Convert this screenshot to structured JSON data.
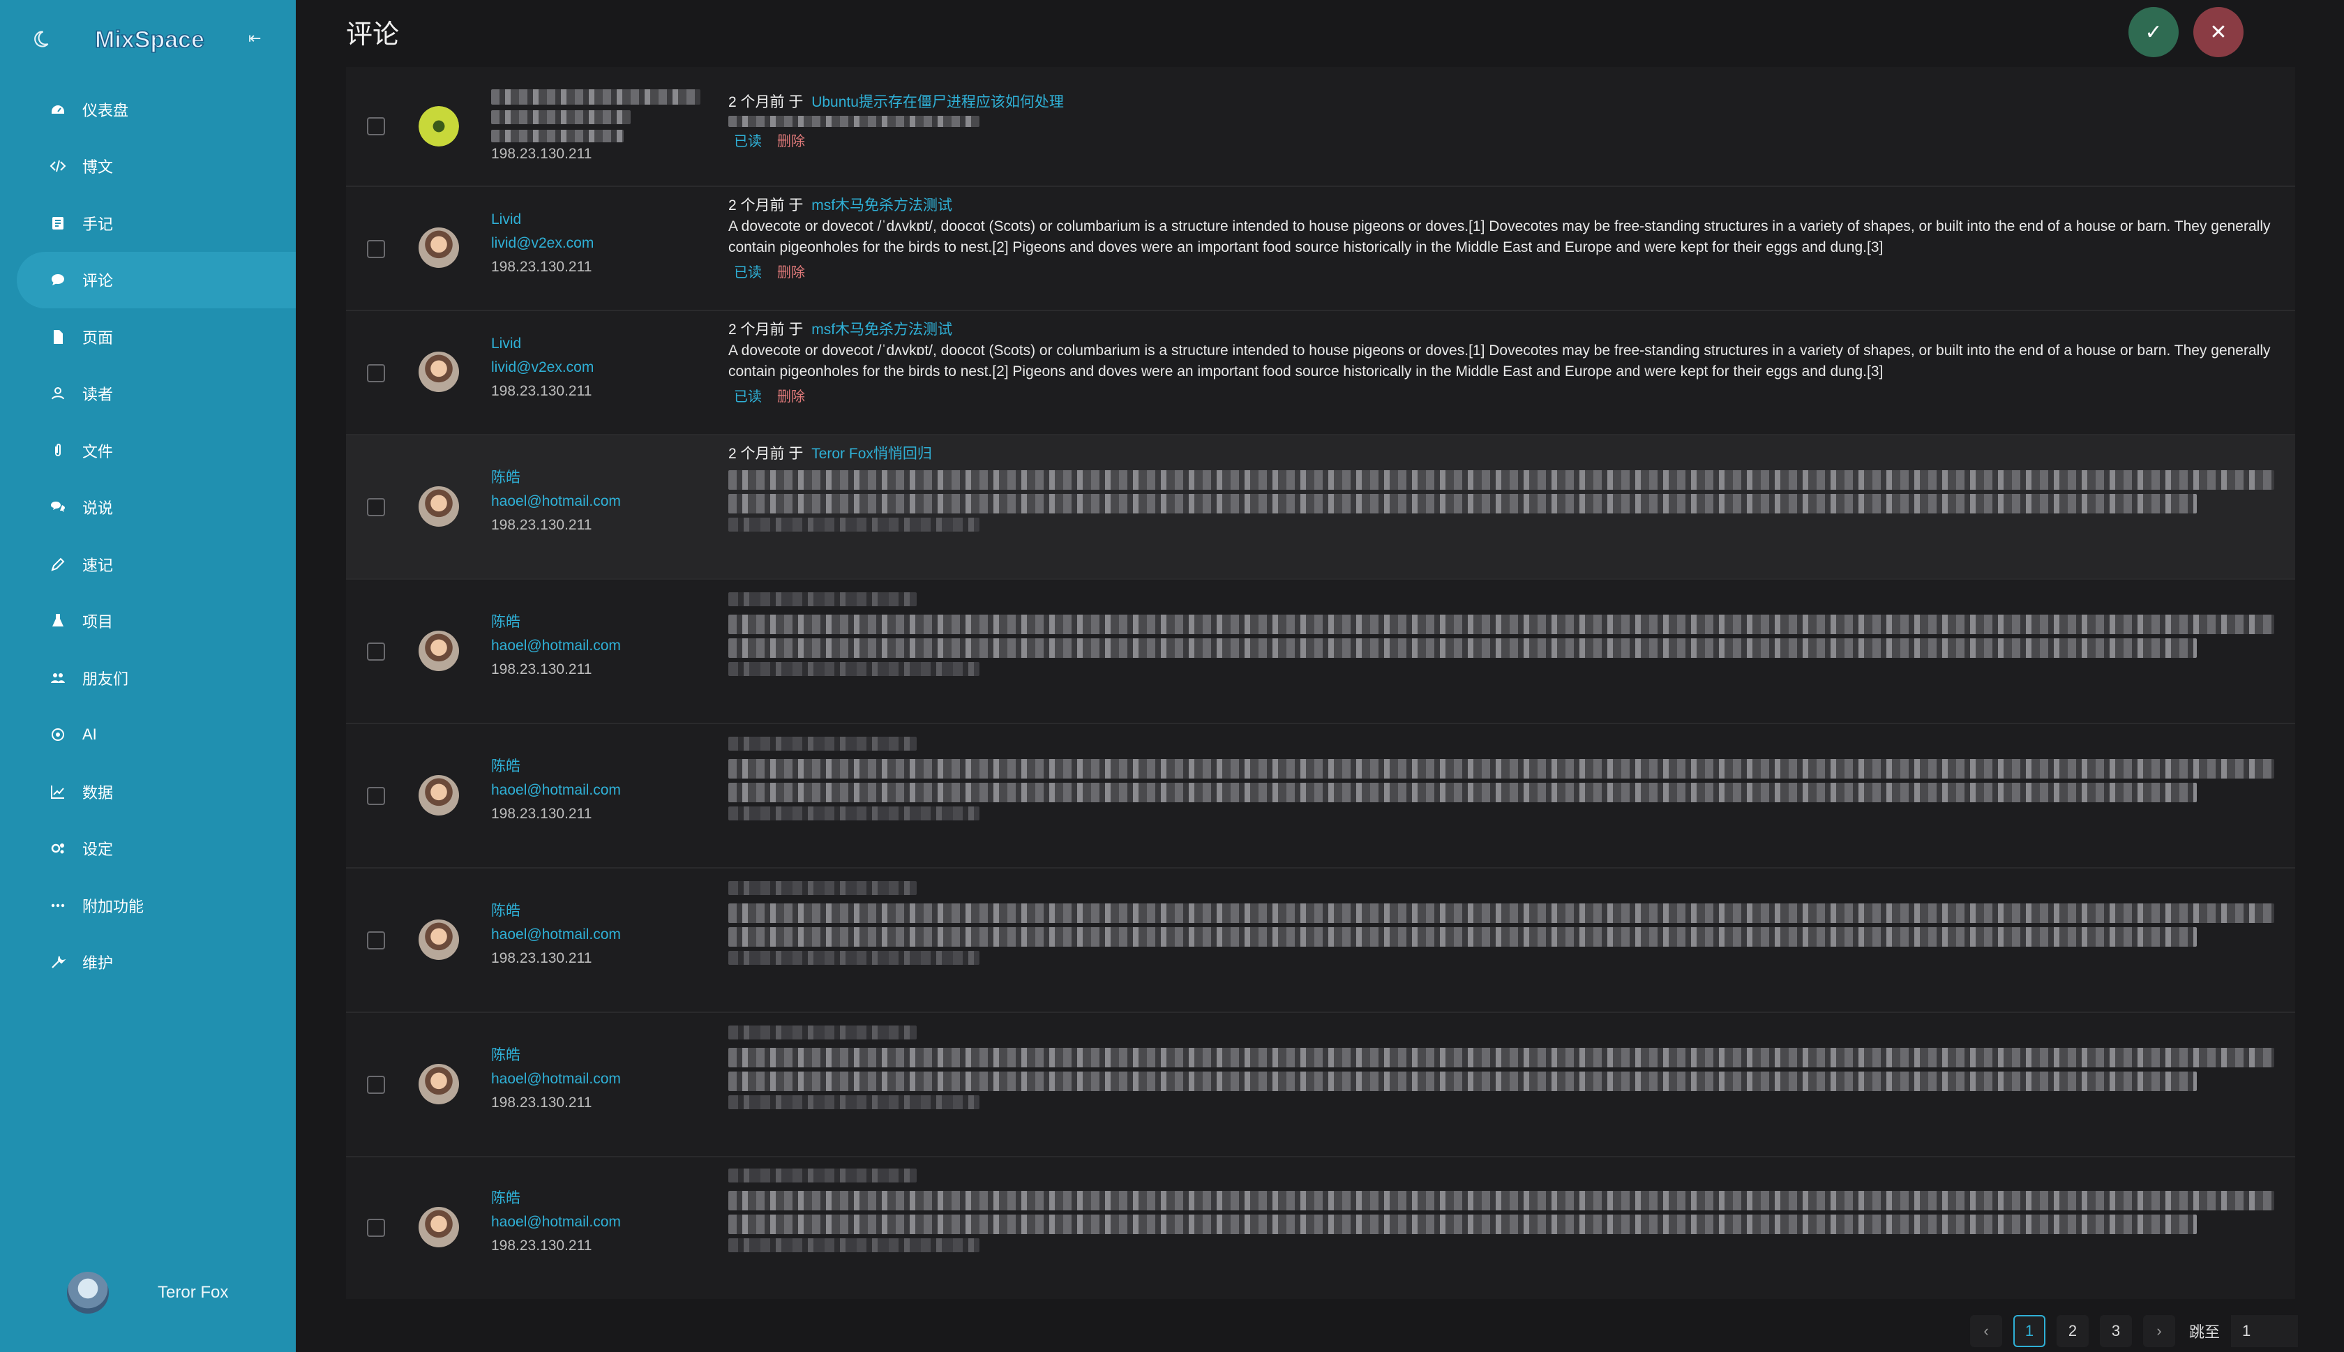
{
  "app": {
    "logo_text": "MixSpace",
    "user": "Teror Fox"
  },
  "sidebar": {
    "items": [
      {
        "label": "仪表盘",
        "icon": "dashboard-icon"
      },
      {
        "label": "博文",
        "icon": "code-icon"
      },
      {
        "label": "手记",
        "icon": "notebook-icon"
      },
      {
        "label": "评论",
        "icon": "comment-icon",
        "active": true
      },
      {
        "label": "页面",
        "icon": "page-icon"
      },
      {
        "label": "读者",
        "icon": "readers-icon"
      },
      {
        "label": "文件",
        "icon": "paperclip-icon"
      },
      {
        "label": "说说",
        "icon": "chat-icon"
      },
      {
        "label": "速记",
        "icon": "pencil-icon"
      },
      {
        "label": "项目",
        "icon": "flask-icon"
      },
      {
        "label": "朋友们",
        "icon": "friends-icon"
      },
      {
        "label": "AI",
        "icon": "ai-icon"
      },
      {
        "label": "数据",
        "icon": "chart-icon"
      },
      {
        "label": "设定",
        "icon": "settings-icon"
      },
      {
        "label": "附加功能",
        "icon": "more-icon"
      },
      {
        "label": "维护",
        "icon": "wrench-icon"
      }
    ]
  },
  "header": {
    "title": "评论",
    "ok_symbol": "✓",
    "cancel_symbol": "✕"
  },
  "comments": [
    {
      "name": "",
      "email": "",
      "ip": "198.23.130.211",
      "time": "2 个月前",
      "on": "于",
      "post": "Ubuntu提示存在僵尸进程应该如何处理",
      "text": "",
      "read": "已读",
      "delete": "删除"
    },
    {
      "name": "Livid",
      "email": "livid@v2ex.com",
      "ip": "198.23.130.211",
      "time": "2 个月前",
      "on": "于",
      "post": "msf木马免杀方法测试",
      "text": "A dovecote or dovecot /ˈdʌvkɒt/, doocot (Scots) or columbarium is a structure intended to house pigeons or doves.[1] Dovecotes may be free-standing structures in a variety of shapes, or built into the end of a house or barn. They generally contain pigeonholes for the birds to nest.[2] Pigeons and doves were an important food source historically in the Middle East and Europe and were kept for their eggs and dung.[3]",
      "read": "已读",
      "delete": "删除"
    },
    {
      "name": "Livid",
      "email": "livid@v2ex.com",
      "ip": "198.23.130.211",
      "time": "2 个月前",
      "on": "于",
      "post": "msf木马免杀方法测试",
      "text": "A dovecote or dovecot /ˈdʌvkɒt/, doocot (Scots) or columbarium is a structure intended to house pigeons or doves.[1] Dovecotes may be free-standing structures in a variety of shapes, or built into the end of a house or barn. They generally contain pigeonholes for the birds to nest.[2] Pigeons and doves were an important food source historically in the Middle East and Europe and were kept for their eggs and dung.[3]",
      "read": "已读",
      "delete": "删除"
    },
    {
      "name": "陈皓",
      "email": "haoel@hotmail.com",
      "ip": "198.23.130.211",
      "time": "2 个月前",
      "on": "于",
      "post": "Teror Fox悄悄回归",
      "text": "",
      "read": "",
      "delete": ""
    },
    {
      "name": "陈皓",
      "email": "haoel@hotmail.com",
      "ip": "198.23.130.211",
      "time": "",
      "on": "",
      "post": "",
      "text": "",
      "read": "",
      "delete": ""
    },
    {
      "name": "陈皓",
      "email": "haoel@hotmail.com",
      "ip": "198.23.130.211",
      "time": "",
      "on": "",
      "post": "",
      "text": "",
      "read": "",
      "delete": ""
    },
    {
      "name": "陈皓",
      "email": "haoel@hotmail.com",
      "ip": "198.23.130.211",
      "time": "",
      "on": "",
      "post": "",
      "text": "",
      "read": "",
      "delete": ""
    },
    {
      "name": "陈皓",
      "email": "haoel@hotmail.com",
      "ip": "198.23.130.211",
      "time": "",
      "on": "",
      "post": "",
      "text": "",
      "read": "",
      "delete": ""
    },
    {
      "name": "陈皓",
      "email": "haoel@hotmail.com",
      "ip": "198.23.130.211",
      "time": "",
      "on": "",
      "post": "",
      "text": "",
      "read": "",
      "delete": ""
    }
  ],
  "pagination": {
    "prev": "‹",
    "next": "›",
    "pages": [
      "1",
      "2",
      "3"
    ],
    "current": "1",
    "jump_label": "跳至",
    "jump_value": "1"
  },
  "colors": {
    "sidebar": "#2090b0",
    "accent": "#2fb0d6",
    "danger": "#e07a7a",
    "background": "#18181a"
  }
}
